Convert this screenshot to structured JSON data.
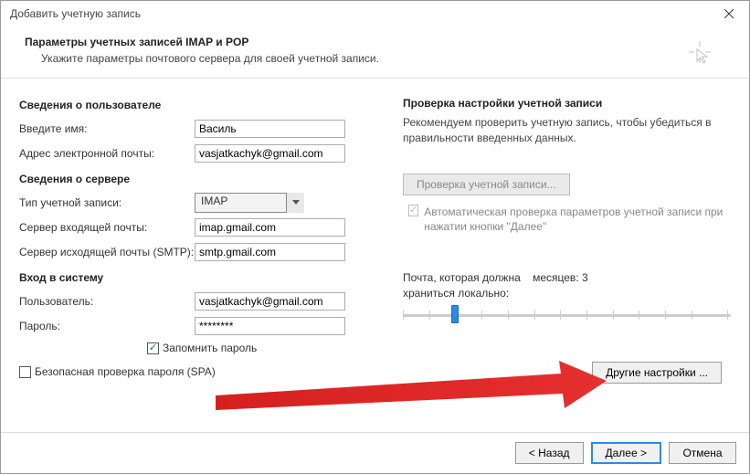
{
  "window": {
    "title": "Добавить учетную запись"
  },
  "header": {
    "title": "Параметры учетных записей IMAP и POP",
    "subtitle": "Укажите параметры почтового сервера для своей учетной записи."
  },
  "userInfo": {
    "section": "Сведения о пользователе",
    "nameLabel": "Введите имя:",
    "nameValue": "Василь",
    "emailLabel": "Адрес электронной почты:",
    "emailValue": "vasjatkachyk@gmail.com"
  },
  "serverInfo": {
    "section": "Сведения о сервере",
    "typeLabel": "Тип учетной записи:",
    "typeValue": "IMAP",
    "incomingLabel": "Сервер входящей почты:",
    "incomingValue": "imap.gmail.com",
    "outgoingLabel": "Сервер исходящей почты (SMTP):",
    "outgoingValue": "smtp.gmail.com"
  },
  "login": {
    "section": "Вход в систему",
    "userLabel": "Пользователь:",
    "userValue": "vasjatkachyk@gmail.com",
    "passLabel": "Пароль:",
    "passValue": "********",
    "rememberLabel": "Запомнить пароль",
    "spaLabel": "Безопасная проверка пароля (SPA)"
  },
  "test": {
    "section": "Проверка настройки учетной записи",
    "text": "Рекомендуем проверить учетную запись, чтобы убедиться в правильности введенных данных.",
    "button": "Проверка учетной записи...",
    "autoLabel": "Автоматическая проверка параметров учетной записи при нажатии кнопки \"Далее\""
  },
  "storage": {
    "label1": "Почта, которая должна",
    "label2": "храниться локально:",
    "valueLabel": "месяцев: 3"
  },
  "otherSettings": "Другие настройки ...",
  "footer": {
    "back": "< Назад",
    "next": "Далее >",
    "cancel": "Отмена"
  }
}
